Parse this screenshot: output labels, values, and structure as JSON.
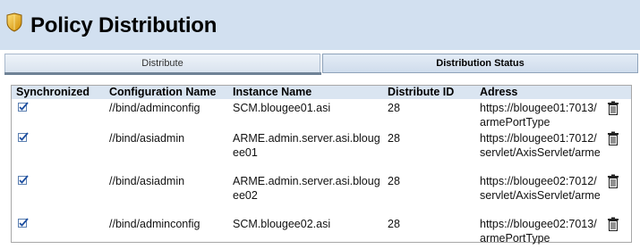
{
  "header": {
    "title": "Policy Distribution"
  },
  "tabs": [
    {
      "label": "Distribute"
    },
    {
      "label": "Distribution Status"
    }
  ],
  "table": {
    "columns": [
      "Synchronized",
      "Configuration Name",
      "Instance Name",
      "Distribute ID",
      "Adress"
    ],
    "rows": [
      {
        "synchronized": true,
        "config": "//bind/adminconfig",
        "instance": "SCM.blougee01.asi",
        "distribute_id": "28",
        "address": "https://blougee01:7013/armePortType"
      },
      {
        "synchronized": true,
        "config": "//bind/asiadmin",
        "instance": "ARME.admin.server.asi.blougee01",
        "distribute_id": "28",
        "address": "https://blougee01:7012/servlet/AxisServlet/arme"
      },
      {
        "synchronized": true,
        "config": "//bind/asiadmin",
        "instance": "ARME.admin.server.asi.blougee02",
        "distribute_id": "28",
        "address": "https://blougee02:7012/servlet/AxisServlet/arme"
      },
      {
        "synchronized": true,
        "config": "//bind/adminconfig",
        "instance": "SCM.blougee02.asi",
        "distribute_id": "28",
        "address": "https://blougee02:7013/armePortType"
      }
    ]
  },
  "icons": {
    "title": "shield-icon",
    "sync": "checkmark-icon",
    "delete": "trash-icon"
  },
  "colors": {
    "header_bg": "#d2e0f0",
    "table_header_bg": "#dae5f1",
    "shield": "#e8b020"
  }
}
